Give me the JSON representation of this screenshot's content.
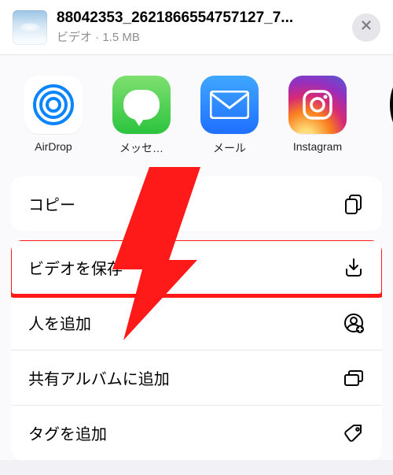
{
  "header": {
    "title": "88042353_2621866554757127_7...",
    "subtitle": "ビデオ · 1.5 MB"
  },
  "apps": [
    {
      "id": "airdrop",
      "label": "AirDrop"
    },
    {
      "id": "messages",
      "label": "メッセ…"
    },
    {
      "id": "mail",
      "label": "メール"
    },
    {
      "id": "instagram",
      "label": "Instagram"
    }
  ],
  "actions": {
    "copy": "コピー",
    "save_video": "ビデオを保存",
    "add_people": "人を追加",
    "shared_album": "共有アルバムに追加",
    "add_tags": "タグを追加"
  }
}
